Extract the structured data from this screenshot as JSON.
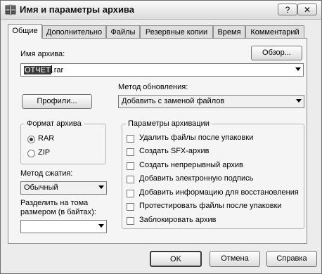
{
  "window": {
    "title": "Имя и параметры архива",
    "help_label": "?",
    "close_label": "✕"
  },
  "tabs": [
    {
      "label": "Общие"
    },
    {
      "label": "Дополнительно"
    },
    {
      "label": "Файлы"
    },
    {
      "label": "Резервные копии"
    },
    {
      "label": "Время"
    },
    {
      "label": "Комментарий"
    }
  ],
  "archive_name": {
    "label": "Имя архива:",
    "browse_label": "Обзор...",
    "value_selected": "ОТЧЕТ",
    "value_rest": ".rar"
  },
  "profiles": {
    "label": "Профили..."
  },
  "update_method": {
    "label": "Метод обновления:",
    "value": "Добавить с заменой файлов"
  },
  "archive_format": {
    "title": "Формат архива",
    "options": [
      "RAR",
      "ZIP"
    ],
    "selected": "RAR"
  },
  "compression": {
    "label": "Метод сжатия:",
    "value": "Обычный"
  },
  "split": {
    "label_line1": "Разделить на тома",
    "label_line2": "размером (в байтах):",
    "value": ""
  },
  "options": {
    "title": "Параметры архивации",
    "items": [
      {
        "label": "Удалить файлы после упаковки",
        "checked": false
      },
      {
        "label": "Создать SFX-архив",
        "checked": false
      },
      {
        "label": "Создать непрерывный архив",
        "checked": false
      },
      {
        "label": "Добавить электронную подпись",
        "checked": false
      },
      {
        "label": "Добавить информацию для восстановления",
        "checked": false
      },
      {
        "label": "Протестировать файлы после упаковки",
        "checked": false
      },
      {
        "label": "Заблокировать архив",
        "checked": false
      }
    ]
  },
  "buttons": {
    "ok": "OK",
    "cancel": "Отмена",
    "help": "Справка"
  }
}
